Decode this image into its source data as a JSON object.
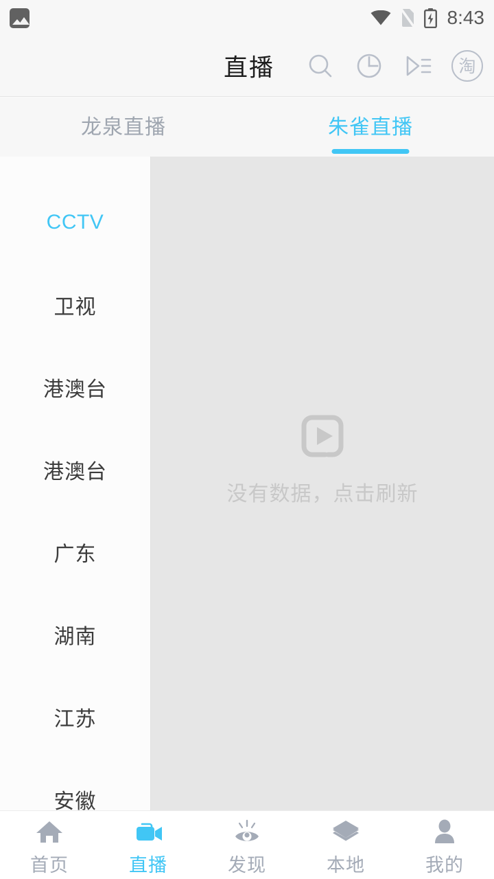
{
  "status_bar": {
    "time": "8:43",
    "icons": [
      "screenshot-image-icon",
      "wifi-icon",
      "no-sim-icon",
      "battery-charging-icon"
    ]
  },
  "header": {
    "title": "直播",
    "actions": [
      {
        "name": "search-icon",
        "label": "搜索"
      },
      {
        "name": "history-clock-icon",
        "label": "历史"
      },
      {
        "name": "playlist-icon",
        "label": "播放列表"
      },
      {
        "name": "taobao-icon",
        "label": "淘"
      }
    ]
  },
  "tabs": [
    {
      "label": "龙泉直播",
      "active": false
    },
    {
      "label": "朱雀直播",
      "active": true
    }
  ],
  "sidebar": {
    "items": [
      {
        "label": "CCTV",
        "active": true
      },
      {
        "label": "卫视",
        "active": false
      },
      {
        "label": "港澳台",
        "active": false
      },
      {
        "label": "港澳台",
        "active": false
      },
      {
        "label": "广东",
        "active": false
      },
      {
        "label": "湖南",
        "active": false
      },
      {
        "label": "江苏",
        "active": false
      },
      {
        "label": "安徽",
        "active": false
      }
    ]
  },
  "content": {
    "empty_icon": "play-video-placeholder-icon",
    "empty_text": "没有数据，点击刷新"
  },
  "bottom_nav": {
    "items": [
      {
        "label": "首页",
        "icon": "home-icon",
        "active": false
      },
      {
        "label": "直播",
        "icon": "video-camera-icon",
        "active": true
      },
      {
        "label": "发现",
        "icon": "eye-discover-icon",
        "active": false
      },
      {
        "label": "本地",
        "icon": "layers-icon",
        "active": false
      },
      {
        "label": "我的",
        "icon": "person-icon",
        "active": false
      }
    ]
  },
  "colors": {
    "accent": "#41c6f5",
    "inactive_text": "#9fa6b0",
    "nav_inactive": "#a4abb7",
    "content_bg": "#e6e6e6",
    "sidebar_bg": "#fcfcfc",
    "header_bg": "#f7f7f7",
    "empty_text": "#c8c8c8"
  }
}
